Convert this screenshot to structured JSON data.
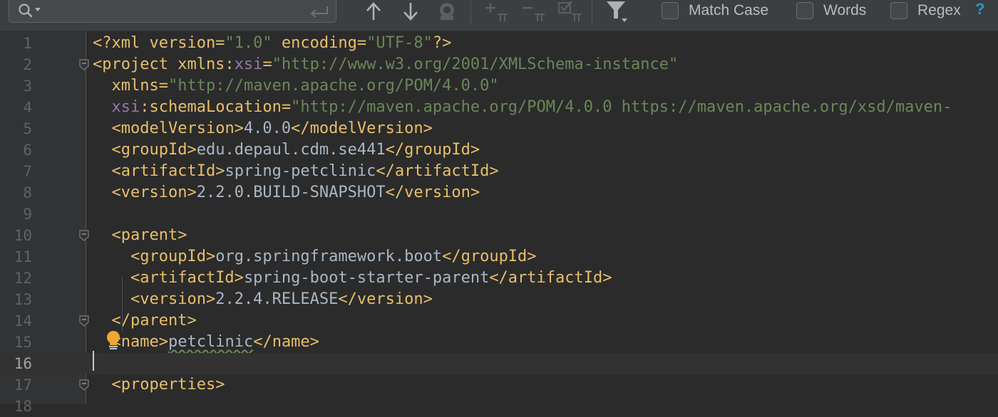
{
  "find_bar": {
    "search_placeholder": "",
    "search_value": "",
    "options": {
      "match_case": {
        "label": "Match Case",
        "checked": false
      },
      "words": {
        "label": "Words",
        "checked": false
      },
      "regex": {
        "label": "Regex",
        "checked": false
      }
    },
    "help_label": "?"
  },
  "editor": {
    "current_line": 16,
    "lines": [
      {
        "num": "1",
        "segments": [
          {
            "t": "tag",
            "s": "<?xml version="
          },
          {
            "t": "val",
            "s": "\"1.0\""
          },
          {
            "t": "tag",
            "s": " encoding="
          },
          {
            "t": "val",
            "s": "\"UTF-8\""
          },
          {
            "t": "tag",
            "s": "?>"
          }
        ]
      },
      {
        "num": "2",
        "segments": [
          {
            "t": "tag",
            "s": "<project xmlns:"
          },
          {
            "t": "ns",
            "s": "xsi"
          },
          {
            "t": "tag",
            "s": "="
          },
          {
            "t": "val",
            "s": "\"http://www.w3.org/2001/XMLSchema-instance\""
          }
        ]
      },
      {
        "num": "3",
        "segments": [
          {
            "t": "txt",
            "s": "  "
          },
          {
            "t": "tag",
            "s": "xmlns="
          },
          {
            "t": "val",
            "s": "\"http://maven.apache.org/POM/4.0.0\""
          }
        ]
      },
      {
        "num": "4",
        "segments": [
          {
            "t": "txt",
            "s": "  "
          },
          {
            "t": "ns",
            "s": "xsi"
          },
          {
            "t": "tag",
            "s": ":schemaLocation="
          },
          {
            "t": "val",
            "s": "\"http://maven.apache.org/POM/4.0.0 https://maven.apache.org/xsd/maven-"
          }
        ]
      },
      {
        "num": "5",
        "segments": [
          {
            "t": "txt",
            "s": "  "
          },
          {
            "t": "tag",
            "s": "<modelVersion>"
          },
          {
            "t": "txt",
            "s": "4.0.0"
          },
          {
            "t": "tag",
            "s": "</modelVersion>"
          }
        ]
      },
      {
        "num": "6",
        "segments": [
          {
            "t": "txt",
            "s": "  "
          },
          {
            "t": "tag",
            "s": "<groupId>"
          },
          {
            "t": "txt",
            "s": "edu.depaul.cdm.se441"
          },
          {
            "t": "tag",
            "s": "</groupId>"
          }
        ]
      },
      {
        "num": "7",
        "segments": [
          {
            "t": "txt",
            "s": "  "
          },
          {
            "t": "tag",
            "s": "<artifactId>"
          },
          {
            "t": "txt",
            "s": "spring-petclinic"
          },
          {
            "t": "tag",
            "s": "</artifactId>"
          }
        ]
      },
      {
        "num": "8",
        "segments": [
          {
            "t": "txt",
            "s": "  "
          },
          {
            "t": "tag",
            "s": "<version>"
          },
          {
            "t": "txt",
            "s": "2.2.0.BUILD-SNAPSHOT"
          },
          {
            "t": "tag",
            "s": "</version>"
          }
        ]
      },
      {
        "num": "9",
        "segments": []
      },
      {
        "num": "10",
        "segments": [
          {
            "t": "txt",
            "s": "  "
          },
          {
            "t": "tag",
            "s": "<parent>"
          }
        ]
      },
      {
        "num": "11",
        "segments": [
          {
            "t": "txt",
            "s": "    "
          },
          {
            "t": "tag",
            "s": "<groupId>"
          },
          {
            "t": "txt",
            "s": "org.springframework.boot"
          },
          {
            "t": "tag",
            "s": "</groupId>"
          }
        ]
      },
      {
        "num": "12",
        "segments": [
          {
            "t": "txt",
            "s": "    "
          },
          {
            "t": "tag",
            "s": "<artifactId>"
          },
          {
            "t": "txt",
            "s": "spring-boot-starter-parent"
          },
          {
            "t": "tag",
            "s": "</artifactId>"
          }
        ]
      },
      {
        "num": "13",
        "segments": [
          {
            "t": "txt",
            "s": "    "
          },
          {
            "t": "tag",
            "s": "<version>"
          },
          {
            "t": "txt",
            "s": "2.2.4.RELEASE"
          },
          {
            "t": "tag",
            "s": "</version>"
          }
        ]
      },
      {
        "num": "14",
        "segments": [
          {
            "t": "txt",
            "s": "  "
          },
          {
            "t": "tag",
            "s": "</parent>"
          }
        ]
      },
      {
        "num": "15",
        "segments": [
          {
            "t": "txt",
            "s": "  "
          },
          {
            "t": "tag",
            "s": "<name>"
          },
          {
            "t": "spell",
            "s": "petclinic"
          },
          {
            "t": "tag",
            "s": "</name>"
          }
        ]
      },
      {
        "num": "16",
        "segments": []
      },
      {
        "num": "17",
        "segments": [
          {
            "t": "txt",
            "s": "  "
          },
          {
            "t": "tag",
            "s": "<properties>"
          }
        ]
      },
      {
        "num": "18",
        "segments": []
      }
    ],
    "fold_markers": [
      "2",
      "10",
      "14",
      "17"
    ]
  },
  "icons": {
    "search": "search-icon",
    "enter": "enter-icon",
    "prev": "arrow-up-icon",
    "next": "arrow-down-icon",
    "select_all": "select-all-occurrences-icon",
    "add_selection": "add-occurrence-icon",
    "remove_selection": "remove-occurrence-icon",
    "toggle_selection": "select-occurrence-icon",
    "filter": "filter-icon",
    "intention": "intention-bulb-icon"
  },
  "colors": {
    "background": "#2b2b2b",
    "tag": "#e8bf6a",
    "value": "#6a8759",
    "namespace": "#9876aa",
    "text": "#a9b7c6",
    "line_number": "#606366",
    "help": "#3592c4"
  }
}
